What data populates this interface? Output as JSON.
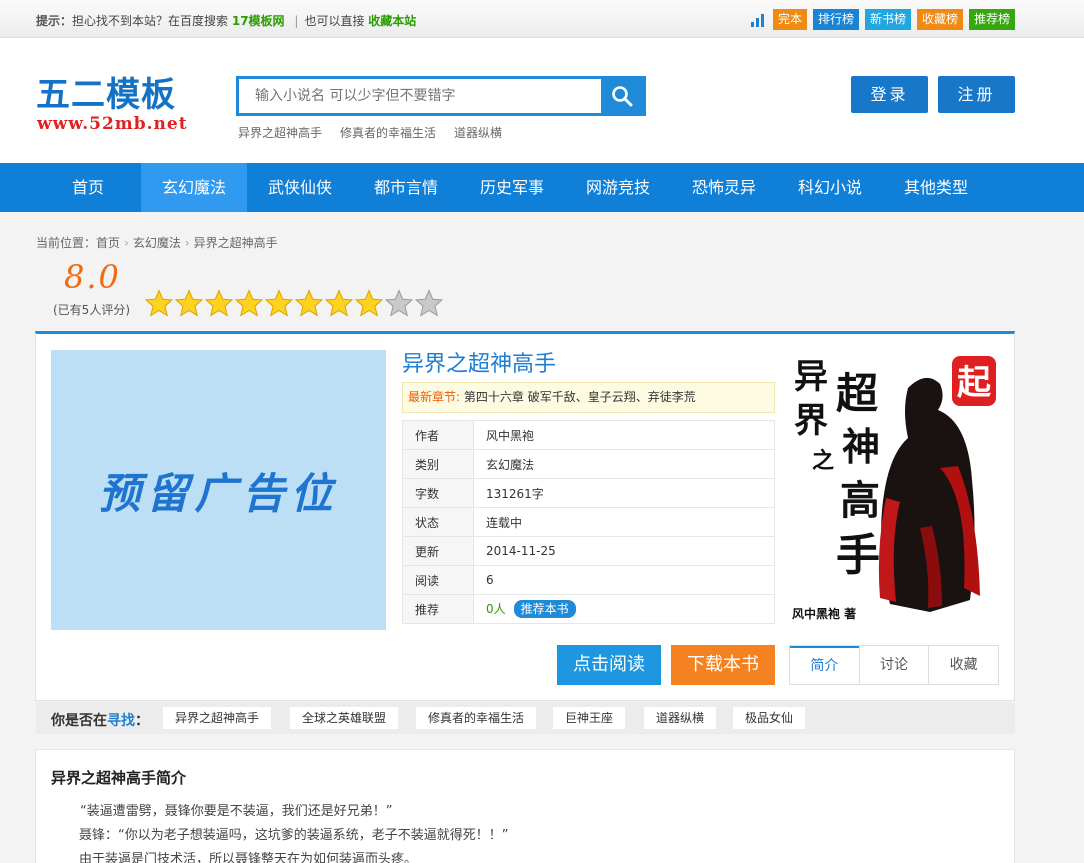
{
  "topbar": {
    "tip_label": "提示：",
    "tip_text": "担心找不到本站？在百度搜索",
    "tip_site": "17模板网",
    "tip_sep": "|",
    "tip_text2": "也可以直接",
    "tip_fav": "收藏本站",
    "quick_links": [
      {
        "label": "完本",
        "color": "#f08a12"
      },
      {
        "label": "排行榜",
        "color": "#1a84d4"
      },
      {
        "label": "新书榜",
        "color": "#21a7de"
      },
      {
        "label": "收藏榜",
        "color": "#f08a12"
      },
      {
        "label": "推荐榜",
        "color": "#37a70f"
      }
    ]
  },
  "header": {
    "logo": "五二模板",
    "logo_url": "www.52mb.net",
    "search_placeholder": "输入小说名 可以少字但不要错字",
    "hot_words": [
      "异界之超神高手",
      "修真者的幸福生活",
      "道器纵横"
    ],
    "login": "登录",
    "register": "注册"
  },
  "nav": [
    "首页",
    "玄幻魔法",
    "武侠仙侠",
    "都市言情",
    "历史军事",
    "网游竞技",
    "恐怖灵异",
    "科幻小说",
    "其他类型"
  ],
  "breadcrumb": {
    "prefix": "当前位置：",
    "home": "首页",
    "category": "玄幻魔法",
    "current": "异界之超神高手"
  },
  "rating": {
    "score": "8.0",
    "note": "(已有5人评分)",
    "filled_stars": 8,
    "total_stars": 10
  },
  "ad_text": "预留广告位",
  "book": {
    "title": "异界之超神高手",
    "latest_label": "最新章节:",
    "latest_chapter": "第四十六章 破军千敌、皇子云翔、弃徒李荒",
    "info": [
      {
        "k": "作者",
        "v": "风中黑袍"
      },
      {
        "k": "类别",
        "v": "玄幻魔法"
      },
      {
        "k": "字数",
        "v": "131261字"
      },
      {
        "k": "状态",
        "v": "连载中"
      },
      {
        "k": "更新",
        "v": "2014-11-25"
      },
      {
        "k": "阅读",
        "v": "6"
      }
    ],
    "recommend_label": "推荐",
    "recommend_value": "0人",
    "recommend_button": "推荐本书",
    "cover_text": [
      "异",
      "界",
      "之",
      "超",
      "神",
      "高",
      "手"
    ],
    "cover_author": "风中黑袍 著",
    "cover_badge": "起"
  },
  "actions": {
    "read": "点击阅读",
    "download": "下载本书",
    "tabs": [
      "简介",
      "讨论",
      "收藏"
    ]
  },
  "find": {
    "label_prefix": "你是否在",
    "label_blue": "寻找",
    "label_suffix": "：",
    "tags": [
      "异界之超神高手",
      "全球之英雄联盟",
      "修真者的幸福生活",
      "巨神王座",
      "道器纵横",
      "极品女仙"
    ]
  },
  "intro": {
    "heading": "异界之超神高手简介",
    "lines": [
      "“装逼遭雷劈，聂锋你要是不装逼，我们还是好兄弟！”",
      "聂锋：“你以为老子想装逼吗，这坑爹的装逼系统，老子不装逼就得死！！”",
      "由于装逼是门技术活，所以聂锋整天在为如何装逼而头疼。"
    ]
  }
}
